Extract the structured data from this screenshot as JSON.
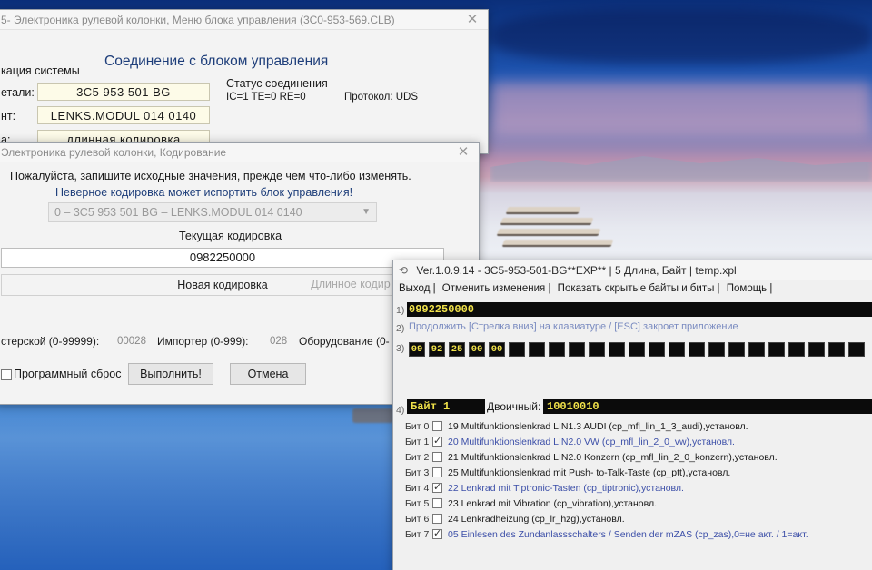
{
  "win1": {
    "title": "5- Электроника рулевой колонки,  Меню блока управления  (3C0-953-569.CLB)",
    "header": "Соединение с блоком управления",
    "sys_label": "кация системы",
    "part_label": "етали:",
    "part_value": "3C5 953 501 BG",
    "comp_label": "нт:",
    "comp_value": "LENKS.MODUL   014 0140",
    "cod_label": "а:",
    "cod_value": "длинная кодировка",
    "status_title": "Статус соединения",
    "status_values": "IC=1  TE=0   RE=0",
    "protocol": "Протокол: UDS"
  },
  "win2": {
    "title": "Электроника рулевой колонки,  Кодирование",
    "warning1": "Пожалуйста, запишите исходные значения, прежде чем что-либо изменять.",
    "warning2": "Неверное кодировка может испортить блок управления!",
    "select_value": "0 – 3C5 953 501 BG – LENKS.MODUL   014 0140",
    "current_label": "Текущая кодировка",
    "current_value": "0982250000",
    "new_button": "Новая кодировка",
    "long_button": "Длинное кодир",
    "workshop_label": "стерской (0-99999):",
    "workshop_value": "00028",
    "importer_label": "Импортер (0-999):",
    "importer_value": "028",
    "equipment_label": "Оборудование (0-",
    "soft_reset_label": "Программный сброс",
    "execute_button": "Выполнить!",
    "cancel_button": "Отмена"
  },
  "win3": {
    "title": "Ver.1.0.9.14 -   3C5-953-501-BG**EXP** | 5 Длина, Байт | temp.xpl",
    "menu": [
      "Выход |",
      "Отменить изменения |",
      "Показать скрытые байты и биты |",
      "Помощь |"
    ],
    "line1_num": "1)",
    "line1_value": "0992250000",
    "line2_num": "2)",
    "line2_text": "Продолжить [Стрелка вниз] на клавиатуре / [ESC] закроет приложение",
    "line3_num": "3)",
    "bytes": [
      "09",
      "92",
      "25",
      "00",
      "00"
    ],
    "line4_num": "4)",
    "byte_label": "Байт 1",
    "binary_label": "Двоичный:",
    "binary_value": "10010010",
    "bits": [
      {
        "label": "Бит 0",
        "checked": false,
        "text": "19 Multifunktionslenkrad LIN1.3 AUDI (cp_mfl_lin_1_3_audi),установл."
      },
      {
        "label": "Бит 1",
        "checked": true,
        "text": "20 Multifunktionslenkrad LIN2.0 VW (cp_mfl_lin_2_0_vw),установл."
      },
      {
        "label": "Бит 2",
        "checked": false,
        "text": "21 Multifunktionslenkrad LIN2.0 Konzern (cp_mfl_lin_2_0_konzern),установл."
      },
      {
        "label": "Бит 3",
        "checked": false,
        "text": "25 Multifunktionslenkrad mit Push- to-Talk-Taste (cp_ptt),установл."
      },
      {
        "label": "Бит 4",
        "checked": true,
        "text": "22 Lenkrad mit Tiptronic-Tasten (cp_tiptronic),установл."
      },
      {
        "label": "Бит 5",
        "checked": false,
        "text": "23 Lenkrad mit Vibration (cp_vibration),установл."
      },
      {
        "label": "Бит 6",
        "checked": false,
        "text": "24 Lenkradheizung (cp_lr_hzg),установл."
      },
      {
        "label": "Бит 7",
        "checked": true,
        "text": "05 Einlesen des Zundanlassschalters / Senden der mZAS (cp_zas),0=не акт. / 1=акт."
      }
    ]
  }
}
